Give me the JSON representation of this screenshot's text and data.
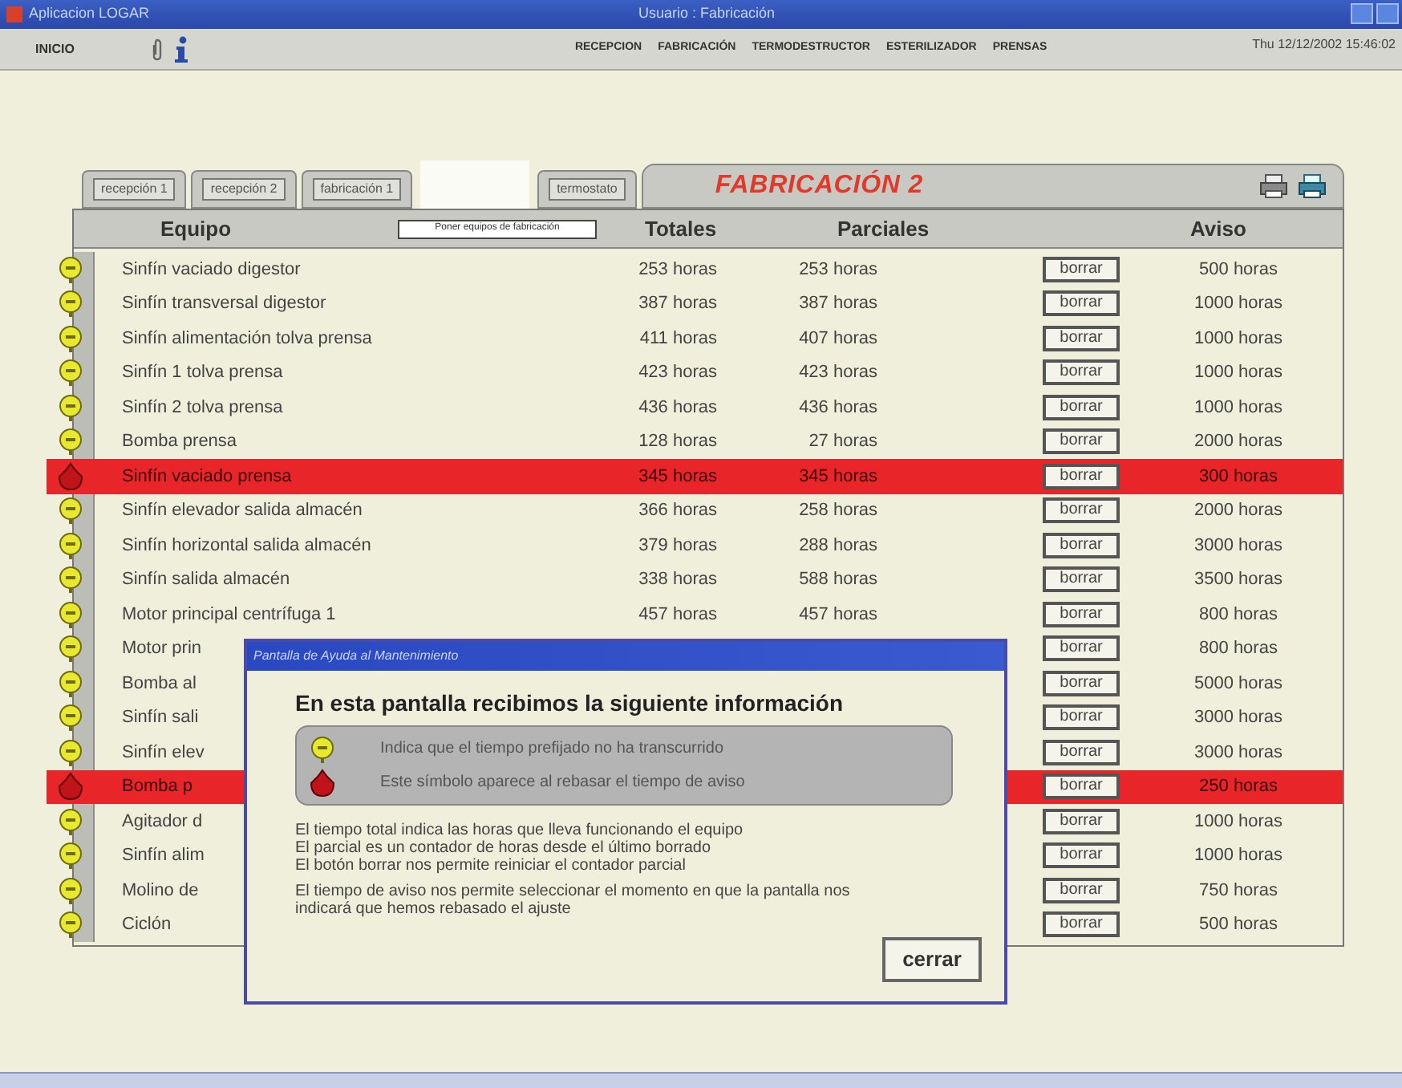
{
  "window": {
    "title": "Aplicacion LOGAR",
    "user": "Usuario : Fabricación"
  },
  "toolbar": {
    "home": "INICIO",
    "menu": [
      "RECEPCION",
      "FABRICACIÓN",
      "TERMODESTRUCTOR",
      "ESTERILIZADOR",
      "PRENSAS"
    ],
    "datetime": "Thu 12/12/2002 15:46:02"
  },
  "tabs": [
    {
      "kind": "tab",
      "label": "recepción 1"
    },
    {
      "kind": "tab",
      "label": "recepción 2"
    },
    {
      "kind": "tab",
      "label": "fabricación 1"
    },
    {
      "kind": "blank"
    },
    {
      "kind": "tab",
      "label": "termostato"
    }
  ],
  "panel": {
    "title": "FABRICACIÓN 2",
    "filter_button": "Poner equipos de fabricación",
    "columns": [
      "Equipo",
      "Totales",
      "Parciales",
      "Aviso"
    ],
    "rows": [
      {
        "name": "Sinfín vaciado digestor",
        "total": "253 horas",
        "partial": "253 horas",
        "button": "borrar",
        "warning": "500 horas",
        "alarm": false
      },
      {
        "name": "Sinfín transversal digestor",
        "total": "387 horas",
        "partial": "387 horas",
        "button": "borrar",
        "warning": "1000 horas",
        "alarm": false
      },
      {
        "name": "Sinfín alimentación tolva prensa",
        "total": "411 horas",
        "partial": "407 horas",
        "button": "borrar",
        "warning": "1000 horas",
        "alarm": false
      },
      {
        "name": "Sinfín 1 tolva prensa",
        "total": "423 horas",
        "partial": "423 horas",
        "button": "borrar",
        "warning": "1000 horas",
        "alarm": false
      },
      {
        "name": "Sinfín 2 tolva prensa",
        "total": "436 horas",
        "partial": "436 horas",
        "button": "borrar",
        "warning": "1000 horas",
        "alarm": false
      },
      {
        "name": "Bomba prensa",
        "total": "128 horas",
        "partial": "27 horas",
        "button": "borrar",
        "warning": "2000 horas",
        "alarm": false
      },
      {
        "name": "Sinfín vaciado prensa",
        "total": "345 horas",
        "partial": "345 horas",
        "button": "borrar",
        "warning": "300 horas",
        "alarm": true
      },
      {
        "name": "Sinfín elevador salida almacén",
        "total": "366 horas",
        "partial": "258 horas",
        "button": "borrar",
        "warning": "2000 horas",
        "alarm": false
      },
      {
        "name": "Sinfín horizontal salida almacén",
        "total": "379 horas",
        "partial": "288 horas",
        "button": "borrar",
        "warning": "3000 horas",
        "alarm": false
      },
      {
        "name": "Sinfín salida almacén",
        "total": "338 horas",
        "partial": "588 horas",
        "button": "borrar",
        "warning": "3500 horas",
        "alarm": false
      },
      {
        "name": "Motor principal centrífuga 1",
        "total": "457 horas",
        "partial": "457 horas",
        "button": "borrar",
        "warning": "800 horas",
        "alarm": false
      },
      {
        "name": "Motor prin",
        "button": "borrar",
        "warning": "800 horas",
        "alarm": false
      },
      {
        "name": "Bomba al",
        "button": "borrar",
        "warning": "5000 horas",
        "alarm": false
      },
      {
        "name": "Sinfín sali",
        "button": "borrar",
        "warning": "3000 horas",
        "alarm": false
      },
      {
        "name": "Sinfín elev",
        "button": "borrar",
        "warning": "3000 horas",
        "alarm": false
      },
      {
        "name": "Bomba p",
        "button": "borrar",
        "warning": "250 horas",
        "alarm": true
      },
      {
        "name": "Agitador d",
        "button": "borrar",
        "warning": "1000 horas",
        "alarm": false
      },
      {
        "name": "Sinfín alim",
        "button": "borrar",
        "warning": "1000 horas",
        "alarm": false
      },
      {
        "name": "Molino de",
        "button": "borrar",
        "warning": "750 horas",
        "alarm": false
      },
      {
        "name": "Ciclón",
        "button": "borrar",
        "warning": "500 horas",
        "alarm": false
      }
    ]
  },
  "dialog": {
    "title": "Pantalla de Ayuda al Mantenimiento",
    "heading": "En esta pantalla recibimos la siguiente información",
    "legend": [
      {
        "kind": "ok",
        "text": "Indica que el tiempo prefijado no ha transcurrido"
      },
      {
        "kind": "alarm",
        "text": "Este símbolo aparece al rebasar el tiempo de aviso"
      }
    ],
    "lines": [
      "El tiempo total indica las horas que lleva funcionando el equipo",
      "El parcial es un contador de horas desde el último borrado",
      "El botón borrar nos permite reiniciar el contador parcial"
    ],
    "note": "El tiempo de aviso nos permite seleccionar el momento en que la pantalla nos indicará que hemos rebasado el ajuste",
    "close": "cerrar"
  }
}
